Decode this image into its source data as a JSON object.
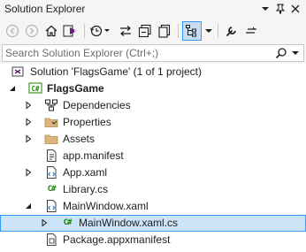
{
  "titlebar": {
    "title": "Solution Explorer",
    "pin_glyph": "▾",
    "close_glyph": "✕"
  },
  "toolbar": {
    "buttons": [
      {
        "name": "back-button",
        "icon": "back-circle-icon"
      },
      {
        "name": "forward-button",
        "icon": "forward-circle-icon"
      },
      {
        "name": "home-button",
        "icon": "home-icon"
      },
      {
        "name": "switch-views-button",
        "icon": "vs-switch-views-icon"
      },
      {
        "name": "pending-changes-button",
        "icon": "history-clock-icon"
      },
      {
        "name": "sync-active-document-button",
        "icon": "sync-arrows-icon"
      },
      {
        "name": "collapse-all-button",
        "icon": "collapse-all-icon"
      },
      {
        "name": "show-all-files-button",
        "icon": "show-all-files-icon"
      },
      {
        "name": "preview-selected-items-button",
        "icon": "hierarchy-icon"
      },
      {
        "name": "properties-button",
        "icon": "wrench-icon"
      },
      {
        "name": "more-options-button",
        "icon": "minus-lines-icon"
      }
    ]
  },
  "search": {
    "placeholder": "Search Solution Explorer (Ctrl+;)",
    "value": ""
  },
  "tree": {
    "items": [
      {
        "label": "Solution 'FlagsGame' (1 of 1 project)",
        "icon": "solution-icon",
        "expander": "none",
        "bold": false
      },
      {
        "label": "FlagsGame",
        "icon": "csharp-project-icon",
        "expander": "expanded",
        "bold": true
      },
      {
        "label": "Dependencies",
        "icon": "dependencies-icon",
        "expander": "collapsed",
        "bold": false
      },
      {
        "label": "Properties",
        "icon": "properties-folder-icon",
        "expander": "collapsed",
        "bold": false
      },
      {
        "label": "Assets",
        "icon": "folder-icon",
        "expander": "collapsed",
        "bold": false
      },
      {
        "label": "app.manifest",
        "icon": "manifest-file-icon",
        "expander": "none",
        "bold": false
      },
      {
        "label": "App.xaml",
        "icon": "xaml-file-icon",
        "expander": "collapsed",
        "bold": false
      },
      {
        "label": "Library.cs",
        "icon": "csharp-file-icon",
        "expander": "none",
        "bold": false
      },
      {
        "label": "MainWindow.xaml",
        "icon": "xaml-file-icon",
        "expander": "expanded",
        "bold": false
      },
      {
        "label": "MainWindow.xaml.cs",
        "icon": "csharp-file-icon",
        "expander": "collapsed",
        "bold": false,
        "selected": true
      },
      {
        "label": "Package.appxmanifest",
        "icon": "package-manifest-icon",
        "expander": "none",
        "bold": false
      }
    ]
  },
  "colors": {
    "selection": "#cce4f7",
    "selection_border": "#3399ff",
    "csharp_green": "#178600",
    "folder_yellow": "#dcb67a"
  }
}
